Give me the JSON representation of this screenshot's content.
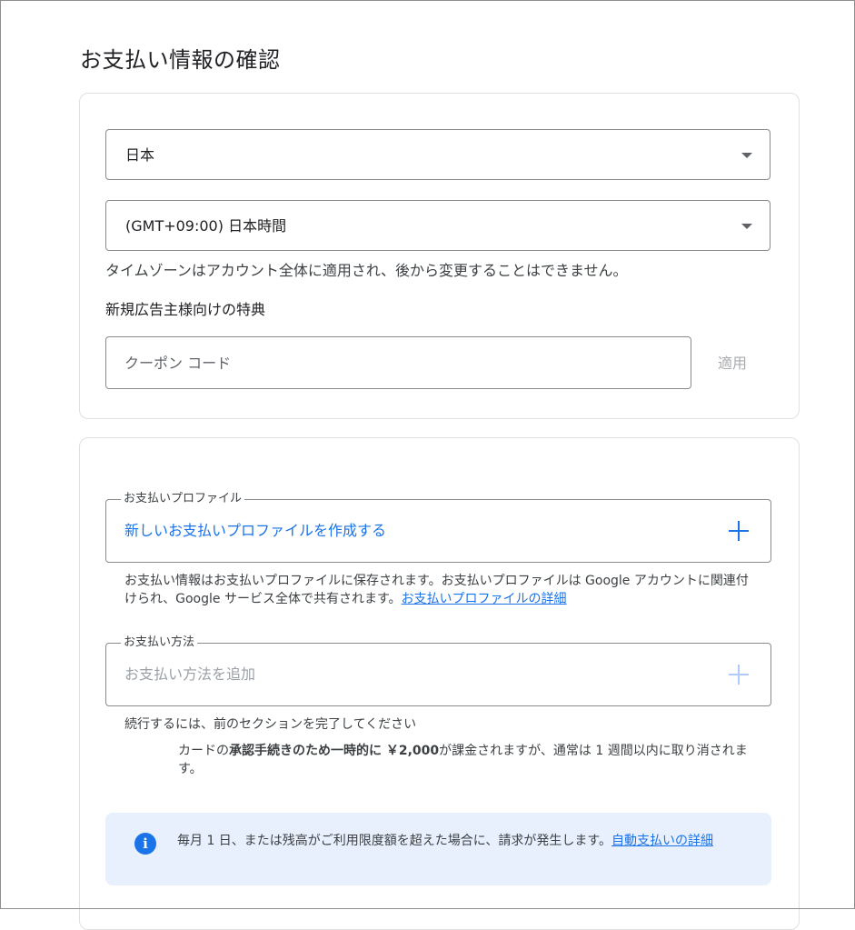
{
  "page": {
    "title": "お支払い情報の確認"
  },
  "account": {
    "country_value": "日本",
    "timezone_value": "(GMT+09:00) 日本時間",
    "timezone_helper": "タイムゾーンはアカウント全体に適用され、後から変更することはできません。"
  },
  "promo": {
    "heading": "新規広告主様向けの特典",
    "coupon_placeholder": "クーポン コード",
    "apply_label": "適用"
  },
  "payment_profile": {
    "legend": "お支払いプロファイル",
    "create_label": "新しいお支払いプロファイルを作成する",
    "description": "お支払い情報はお支払いプロファイルに保存されます。お支払いプロファイルは Google アカウントに関連付けられ、Google サービス全体で共有されます。",
    "details_link": "お支払いプロファイルの詳細"
  },
  "payment_method": {
    "legend": "お支払い方法",
    "add_placeholder": "お支払い方法を追加",
    "helper": "続行するには、前のセクションを完了してください",
    "charge_prefix": "カードの",
    "charge_bold": "承認手続きのため一時的に ￥2,000",
    "charge_suffix": "が課金されますが、通常は 1 週間以内に取り消されます。"
  },
  "info": {
    "text": "毎月 1 日、または残高がご利用限度額を超えた場合に、請求が発生します。",
    "link": "自動支払いの詳細"
  },
  "colors": {
    "accent": "#1a73e8",
    "info_background": "#e8f0fe",
    "disabled_text": "#9aa0a6"
  }
}
